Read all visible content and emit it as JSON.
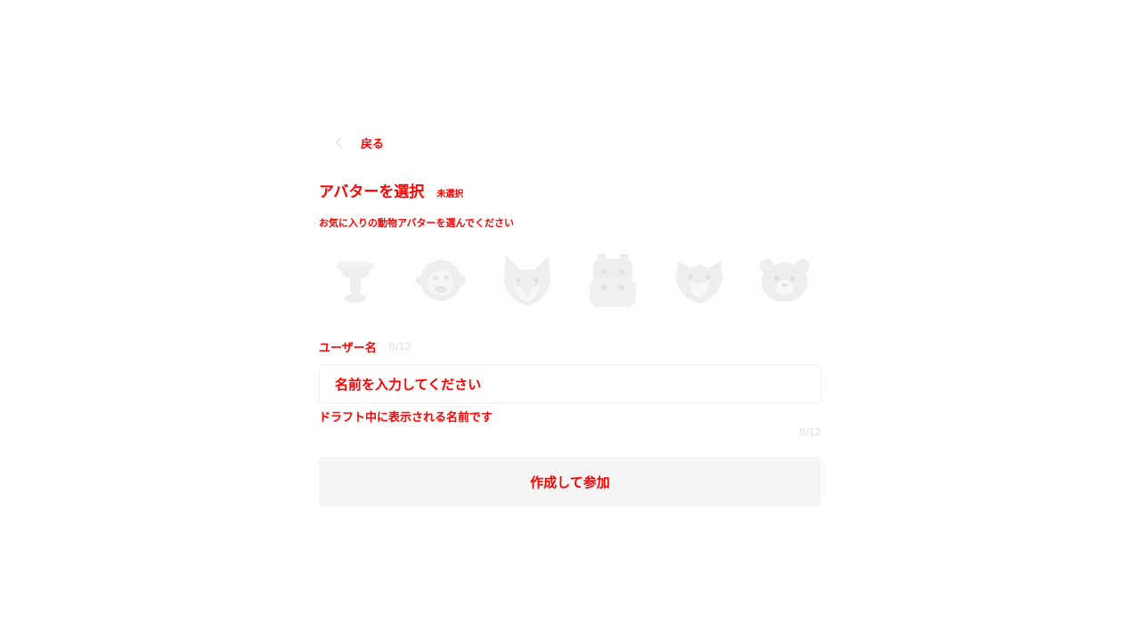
{
  "nav": {
    "back_label": "戻る",
    "back_icon": "chevron-left-icon"
  },
  "header": {
    "title": "アバターを選択",
    "status": "未選択",
    "subtitle": "お気に入りの動物アバターを選んでください"
  },
  "avatars": [
    {
      "icon": "cow-icon"
    },
    {
      "icon": "monkey-icon"
    },
    {
      "icon": "cat-icon"
    },
    {
      "icon": "hippo-icon"
    },
    {
      "icon": "wolf-icon"
    },
    {
      "icon": "bear-icon"
    }
  ],
  "username": {
    "label": "ユーザー名",
    "count": "0/12",
    "placeholder": "名前を入力してください",
    "helper": "ドラフト中に表示される名前です",
    "counter": "0/12"
  },
  "submit": {
    "label": "作成して参加"
  },
  "colors": {
    "label_text": "#ff0000",
    "icon_gray": "#eeeeee",
    "button_bg": "#f5f5f5",
    "border": "#f0f0f0"
  }
}
